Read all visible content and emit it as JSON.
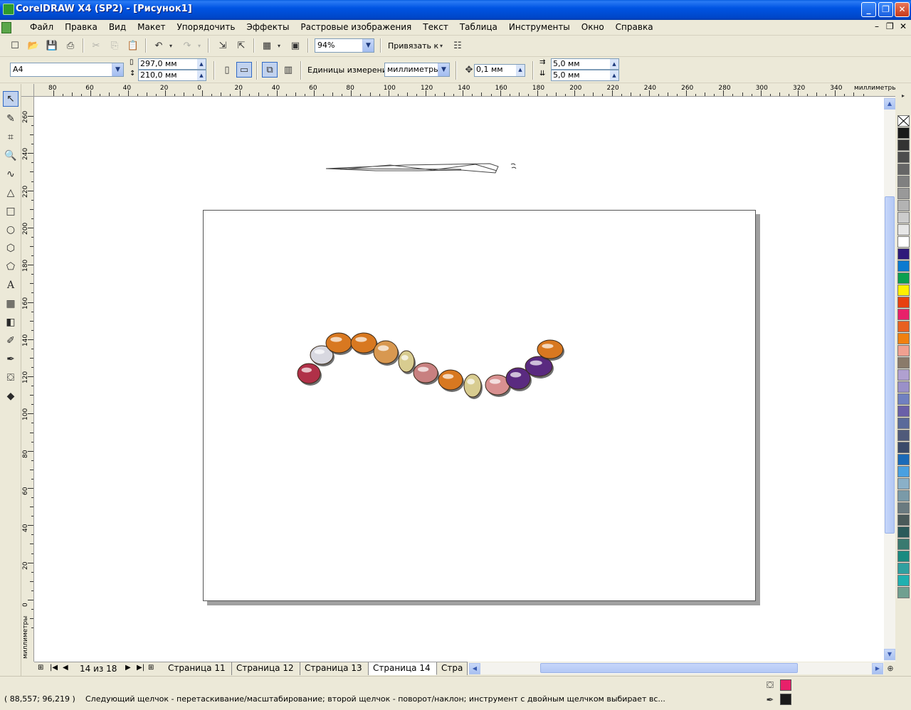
{
  "window": {
    "title": "CorelDRAW X4 (SP2) - [Рисунок1]",
    "min": "_",
    "max": "❐",
    "close": "✕"
  },
  "menu": [
    "Файл",
    "Правка",
    "Вид",
    "Макет",
    "Упорядочить",
    "Эффекты",
    "Растровые изображения",
    "Текст",
    "Таблица",
    "Инструменты",
    "Окно",
    "Справка"
  ],
  "mdi": {
    "min": "–",
    "restore": "❐",
    "close": "✕"
  },
  "standard": {
    "zoom": "94%",
    "snap": "Привязать к"
  },
  "property": {
    "paper": "A4",
    "width": "297,0 мм",
    "height": "210,0 мм",
    "units_label": "Единицы измерения:",
    "units": "миллиметры",
    "nudge": "0,1 мм",
    "dup_x": "5,0 мм",
    "dup_y": "5,0 мм"
  },
  "ruler": {
    "unit": "миллиметры",
    "h_labels": [
      "80",
      "60",
      "40",
      "20",
      "0",
      "20",
      "40",
      "60",
      "80",
      "100",
      "120",
      "140",
      "160",
      "180",
      "200",
      "220",
      "240",
      "260",
      "280",
      "300",
      "320",
      "340"
    ],
    "v_labels": [
      "260",
      "240",
      "220",
      "200",
      "180",
      "160",
      "140",
      "120",
      "100",
      "80",
      "60",
      "40",
      "20",
      "0"
    ]
  },
  "pagenav": {
    "counter": "14 из 18",
    "tabs": [
      "Страница 11",
      "Страница 12",
      "Страница 13",
      "Страница 14",
      "Стра"
    ],
    "active": "Страница 14"
  },
  "status": {
    "coords": "( 88,557; 96,219 )",
    "message": "Следующий щелчок - перетаскивание/масштабирование; второй щелчок - поворот/наклон; инструмент с двойным щелчком выбирает вс...",
    "fill_color": "#e8206a",
    "outline_color": "#1a1a1a"
  },
  "palette": [
    "#1a1a1a",
    "#333333",
    "#4d4d4d",
    "#666666",
    "#808080",
    "#999999",
    "#b3b3b3",
    "#cccccc",
    "#e6e6e6",
    "#ffffff",
    "#2e1a7a",
    "#0a7ad0",
    "#0aa050",
    "#ffef00",
    "#e84010",
    "#e8206a",
    "#e86020",
    "#f08010",
    "#f0a090",
    "#8a7a6a",
    "#b0a0d0",
    "#9a90c8",
    "#7080c0",
    "#6a60a8",
    "#5a6a9a",
    "#505a7a",
    "#3a4a6a",
    "#1a6ab8",
    "#4aa0e0",
    "#8ab0c8",
    "#7a9aa8",
    "#6a7a80",
    "#4a5a5a",
    "#2a5a5a",
    "#3a7a70",
    "#1a8a80",
    "#30a0a0",
    "#20b0b0",
    "#70a090"
  ],
  "gems": [
    {
      "name": "gem-garnet",
      "color": "#b03048"
    },
    {
      "name": "gem-diamond",
      "color": "#d8d8e0"
    },
    {
      "name": "gem-amber",
      "color": "#d87820"
    },
    {
      "name": "gem-amber",
      "color": "#d87820"
    },
    {
      "name": "gem-topaz",
      "color": "#d89850"
    },
    {
      "name": "gem-citrine",
      "color": "#d8cc90"
    },
    {
      "name": "gem-rose",
      "color": "#c88080"
    },
    {
      "name": "gem-amber",
      "color": "#d87820"
    },
    {
      "name": "gem-citrine",
      "color": "#d8cc90"
    },
    {
      "name": "gem-rose",
      "color": "#d89090"
    },
    {
      "name": "gem-amethyst",
      "color": "#5a2a80"
    },
    {
      "name": "gem-amethyst",
      "color": "#5a2a80"
    },
    {
      "name": "gem-amber",
      "color": "#d87820"
    }
  ]
}
